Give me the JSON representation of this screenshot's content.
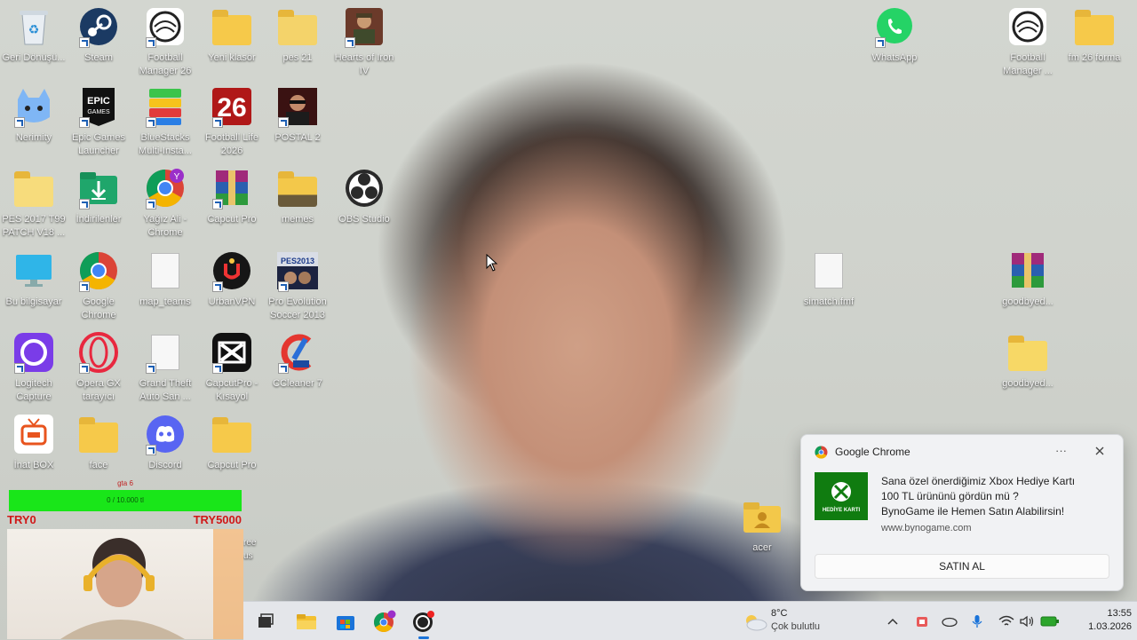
{
  "desktop": {
    "icons": [
      {
        "label": "Geri Dönüşü...",
        "icon": "recycle-bin-icon"
      },
      {
        "label": "Steam",
        "icon": "steam-icon"
      },
      {
        "label": "Football Manager 26",
        "icon": "football-manager-icon"
      },
      {
        "label": "Yeni klasör",
        "icon": "folder-icon"
      },
      {
        "label": "pes 21",
        "icon": "folder-icon"
      },
      {
        "label": "Hearts of Iron IV",
        "icon": "hearts-of-iron-icon"
      },
      {
        "label": "Nerimity",
        "icon": "nerimity-icon"
      },
      {
        "label": "Epic Games Launcher",
        "icon": "epic-games-icon"
      },
      {
        "label": "BlueStacks Multi-Insta...",
        "icon": "bluestacks-icon"
      },
      {
        "label": "Football Life 2026",
        "icon": "football-life-icon"
      },
      {
        "label": "POSTAL 2",
        "icon": "postal2-icon"
      },
      {
        "label": "PES 2017 T99 PATCH V18 ...",
        "icon": "folder-icon"
      },
      {
        "label": "İndirilenler",
        "icon": "downloads-icon"
      },
      {
        "label": "Yağız Ali - Chrome",
        "icon": "chrome-icon"
      },
      {
        "label": "Capcut Pro",
        "icon": "winrar-icon"
      },
      {
        "label": "memes",
        "icon": "folder-icon"
      },
      {
        "label": "OBS Studio",
        "icon": "obs-icon"
      },
      {
        "label": "Bu bilgisayar",
        "icon": "computer-icon"
      },
      {
        "label": "Google Chrome",
        "icon": "chrome-icon"
      },
      {
        "label": "map_teams",
        "icon": "file-icon"
      },
      {
        "label": "UrbanVPN",
        "icon": "urbanvpn-icon"
      },
      {
        "label": "Pro Evolution Soccer 2013",
        "icon": "pes2013-icon"
      },
      {
        "label": "Logitech Capture",
        "icon": "logitech-capture-icon"
      },
      {
        "label": "Opera GX tarayıcı",
        "icon": "opera-gx-icon"
      },
      {
        "label": "Grand Theft Auto San ...",
        "icon": "file-icon"
      },
      {
        "label": "CapcutPro - Kısayol",
        "icon": "capcut-icon"
      },
      {
        "label": "CCleaner 7",
        "icon": "ccleaner-icon"
      },
      {
        "label": "İnat BOX",
        "icon": "inatbox-icon"
      },
      {
        "label": "face",
        "icon": "folder-icon"
      },
      {
        "label": "Discord",
        "icon": "discord-icon"
      },
      {
        "label": "Capcut Pro",
        "icon": "folder-icon"
      },
      {
        "label": "WhatsApp",
        "icon": "whatsapp-icon"
      },
      {
        "label": "Football Manager ...",
        "icon": "football-manager-icon"
      },
      {
        "label": "fm 26 forma",
        "icon": "folder-icon"
      },
      {
        "label": "simatch.fmf",
        "icon": "file-icon"
      },
      {
        "label": "goodbyed...",
        "icon": "winrar-icon"
      },
      {
        "label": "goodbyed...",
        "icon": "folder-icon"
      },
      {
        "label": "acer",
        "icon": "user-folder-icon"
      }
    ],
    "partial_labels": [
      "ree",
      "us"
    ]
  },
  "stream_overlay": {
    "goal_title": "gta 6",
    "goal_bar_text": "0 / 10.000 tl",
    "try_left": "TRY0",
    "try_right": "TRY5000",
    "colors": {
      "bar": "#19e619",
      "try": "#d01818"
    }
  },
  "notification": {
    "app": "Google Chrome",
    "more": "···",
    "message_line1": "Sana özel önerdiğimiz Xbox Hediye Kartı",
    "message_line2": "100 TL ürününü gördün mü ?",
    "message_line3": "BynoGame ile Hemen Satın Alabilirsin!",
    "url": "www.bynogame.com",
    "action": "SATIN AL",
    "thumb_label": "HEDİYE KARTI",
    "thumb_color": "#107c10"
  },
  "taskbar": {
    "weather_temp": "8°C",
    "weather_desc": "Çok bulutlu",
    "time": "13:55",
    "date": "1.03.2026",
    "apps": [
      "task-view-icon",
      "file-explorer-icon",
      "microsoft-store-icon",
      "chrome-icon",
      "football-manager-icon"
    ]
  }
}
